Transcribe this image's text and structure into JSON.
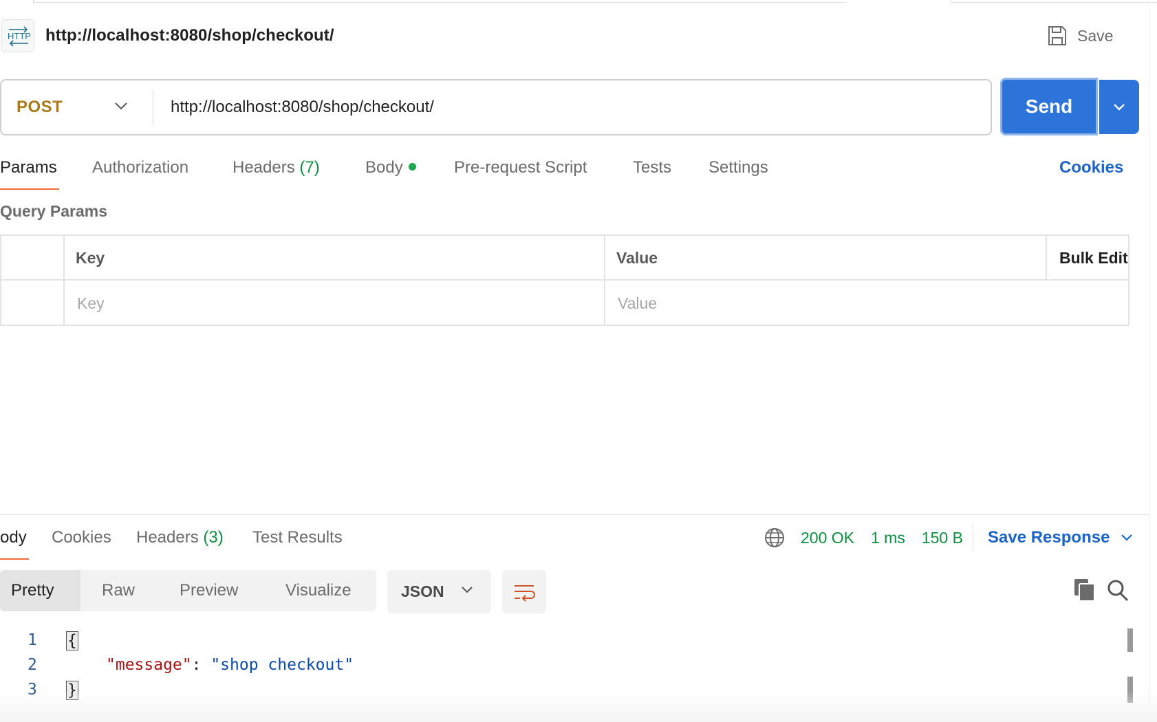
{
  "request": {
    "title": "http://localhost:8080/shop/checkout/",
    "save_label": "Save",
    "method": "POST",
    "url": "http://localhost:8080/shop/checkout/",
    "send_label": "Send",
    "method_color": "#a97a1c"
  },
  "request_tabs": {
    "params": "Params",
    "authorization": "Authorization",
    "headers": "Headers",
    "headers_count": "(7)",
    "body": "Body",
    "prerequest": "Pre-request Script",
    "tests": "Tests",
    "settings": "Settings",
    "active": "Params"
  },
  "cookies_link": "Cookies",
  "query_params": {
    "title": "Query Params",
    "columns": {
      "key": "Key",
      "value": "Value",
      "bulk_edit": "Bulk Edit"
    },
    "placeholder_key": "Key",
    "placeholder_value": "Value"
  },
  "response": {
    "tabs": {
      "body": "ody",
      "cookies": "Cookies",
      "headers": "Headers",
      "headers_count": "(3)",
      "test_results": "Test Results",
      "active": "Body"
    },
    "status": "200 OK",
    "time": "1 ms",
    "size": "150 B",
    "save_response": "Save Response",
    "formats": {
      "pretty": "Pretty",
      "raw": "Raw",
      "preview": "Preview",
      "visualize": "Visualize",
      "active": "Pretty"
    },
    "language": "JSON",
    "code_lines": [
      {
        "n": "1",
        "open": "{"
      },
      {
        "n": "2",
        "key": "\"message\"",
        "colon": ": ",
        "value": "\"shop checkout\""
      },
      {
        "n": "3",
        "close": "}"
      }
    ]
  },
  "colors": {
    "accent": "#2d74da",
    "link": "#1d64c9",
    "status_ok": "#0c8f3f",
    "tab_underline": "#f26b3a",
    "body_dot": "#1fa750"
  },
  "icons": [
    "http-icon",
    "save-icon",
    "chevron-down-icon",
    "globe-icon",
    "wrap-lines-icon",
    "copy-icon",
    "search-icon"
  ]
}
